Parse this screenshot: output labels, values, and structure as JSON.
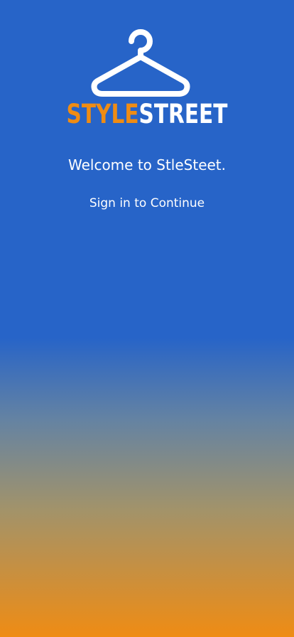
{
  "brand": {
    "name_part1": "STYLE",
    "name_part2": "STREET",
    "logo_icon": "hanger-icon"
  },
  "welcome_text": "Welcome to StleSteet.",
  "signin_text": "Sign in to Continue",
  "colors": {
    "background_top": "#2764c8",
    "background_bottom": "#ef8c14",
    "brand_accent": "#ef8c14",
    "text": "#ffffff"
  }
}
